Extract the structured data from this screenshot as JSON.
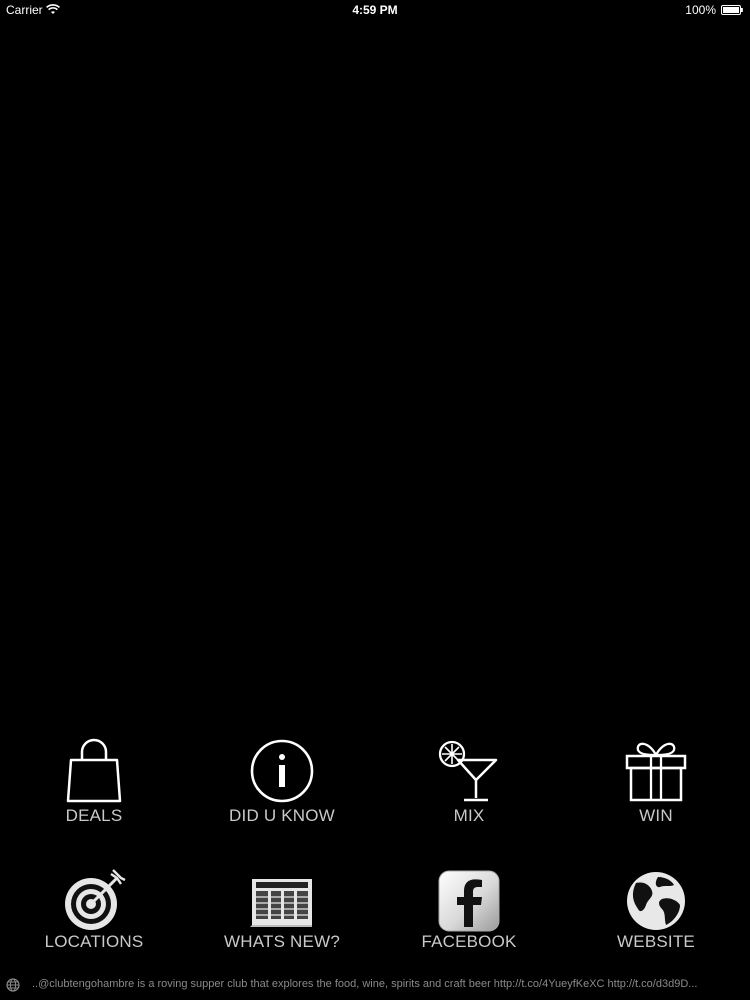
{
  "status_bar": {
    "carrier": "Carrier",
    "time": "4:59 PM",
    "battery": "100%"
  },
  "menu": {
    "row1": [
      {
        "label": "DEALS",
        "icon": "shopping-bag-icon"
      },
      {
        "label": "DID U KNOW",
        "icon": "info-icon"
      },
      {
        "label": "MIX",
        "icon": "cocktail-icon"
      },
      {
        "label": "WIN",
        "icon": "gift-icon"
      }
    ],
    "row2": [
      {
        "label": "LOCATIONS",
        "icon": "target-icon"
      },
      {
        "label": "WHATS NEW?",
        "icon": "newspaper-icon"
      },
      {
        "label": "FACEBOOK",
        "icon": "facebook-icon"
      },
      {
        "label": "WEBSITE",
        "icon": "globe-icon"
      }
    ]
  },
  "ticker": {
    "text": "..@clubtengohambre is a roving supper club that explores the food, wine, spirits and craft beer http://t.co/4YueyfKeXC http://t.co/d3d9D..."
  },
  "colors": {
    "background": "#000000",
    "label": "#c9c9c9",
    "ticker_text": "#8a8a8a"
  }
}
